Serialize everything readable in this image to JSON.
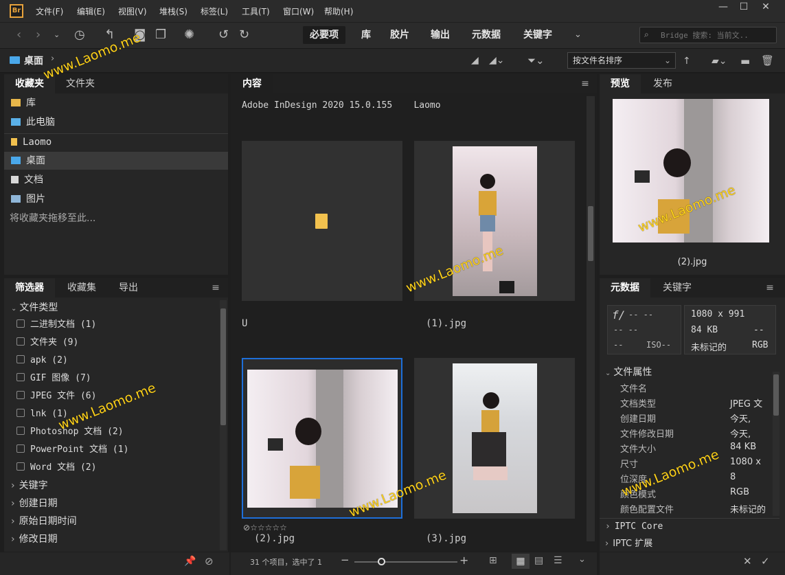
{
  "app": {
    "logo": "Br"
  },
  "menu": [
    "文件(F)",
    "编辑(E)",
    "视图(V)",
    "堆栈(S)",
    "标签(L)",
    "工具(T)",
    "窗口(W)",
    "帮助(H)"
  ],
  "window_controls": {
    "min": "—",
    "max": "☐",
    "close": "✕"
  },
  "workspaces": [
    "必要项",
    "库",
    "胶片",
    "输出",
    "元数据",
    "关键字"
  ],
  "search": {
    "placeholder": "Bridge 搜索: 当前文.."
  },
  "path": {
    "current": "桌面"
  },
  "sort": {
    "label": "按文件名排序"
  },
  "left_top": {
    "tabs": [
      "收藏夹",
      "文件夹"
    ],
    "items": [
      {
        "label": "库",
        "icon": "library-folder-icon"
      },
      {
        "label": "此电脑",
        "icon": "computer-icon"
      },
      {
        "label": "Laomo",
        "icon": "user-folder-icon"
      },
      {
        "label": "桌面",
        "icon": "desktop-icon"
      },
      {
        "label": "文档",
        "icon": "document-icon"
      },
      {
        "label": "图片",
        "icon": "picture-icon"
      }
    ],
    "hint": "将收藏夹拖移至此..."
  },
  "filter": {
    "tabs": [
      "筛选器",
      "收藏集",
      "导出"
    ],
    "filetype_header": "文件类型",
    "filetypes": [
      "二进制文档 (1)",
      "文件夹 (9)",
      "apk (2)",
      "GIF 图像 (7)",
      "JPEG 文件 (6)",
      "lnk (1)",
      "Photoshop 文档 (2)",
      "PowerPoint 文档 (1)",
      "Word 文档 (2)"
    ],
    "sections": [
      "关键字",
      "创建日期",
      "原始日期时间",
      "修改日期"
    ]
  },
  "content": {
    "tab": "内容",
    "header": "Adobe InDesign 2020 15.0.155    Laomo",
    "items": [
      {
        "label": "U"
      },
      {
        "label": "(1).jpg"
      },
      {
        "label": "(2).jpg",
        "rating": "☆☆☆☆☆",
        "reject": "⊘"
      },
      {
        "label": "(3).jpg"
      }
    ],
    "status": "31 个项目，选中了 1"
  },
  "preview": {
    "tabs": [
      "预览",
      "发布"
    ],
    "caption": "(2).jpg"
  },
  "metadata": {
    "tabs": [
      "元数据",
      "关键字"
    ],
    "camera": {
      "f": "f/",
      "dash1": "-- --",
      "dash2": "-- --",
      "dash3": "--",
      "iso": "ISO--"
    },
    "summary": {
      "dimensions": "1080 x 991",
      "size": "84 KB",
      "dash": "--",
      "profile": "未标记的",
      "mode": "RGB"
    },
    "section": "文件属性",
    "props": [
      {
        "k": "文件名",
        "v": ""
      },
      {
        "k": "文档类型",
        "v": "JPEG 文"
      },
      {
        "k": "创建日期",
        "v": "今天,"
      },
      {
        "k": "文件修改日期",
        "v": "今天,"
      },
      {
        "k": "文件大小",
        "v": "84 KB"
      },
      {
        "k": "尺寸",
        "v": "1080 x"
      },
      {
        "k": "位深度",
        "v": "8"
      },
      {
        "k": "颜色模式",
        "v": "RGB"
      },
      {
        "k": "颜色配置文件",
        "v": "未标记的"
      }
    ],
    "more_sections": [
      "IPTC Core",
      "IPTC 扩展"
    ]
  },
  "watermark": "www.Laomo.me",
  "colors": {
    "accent": "#1e6fd9",
    "watermark": "#ffd21a",
    "folder": "#f2c14e"
  }
}
